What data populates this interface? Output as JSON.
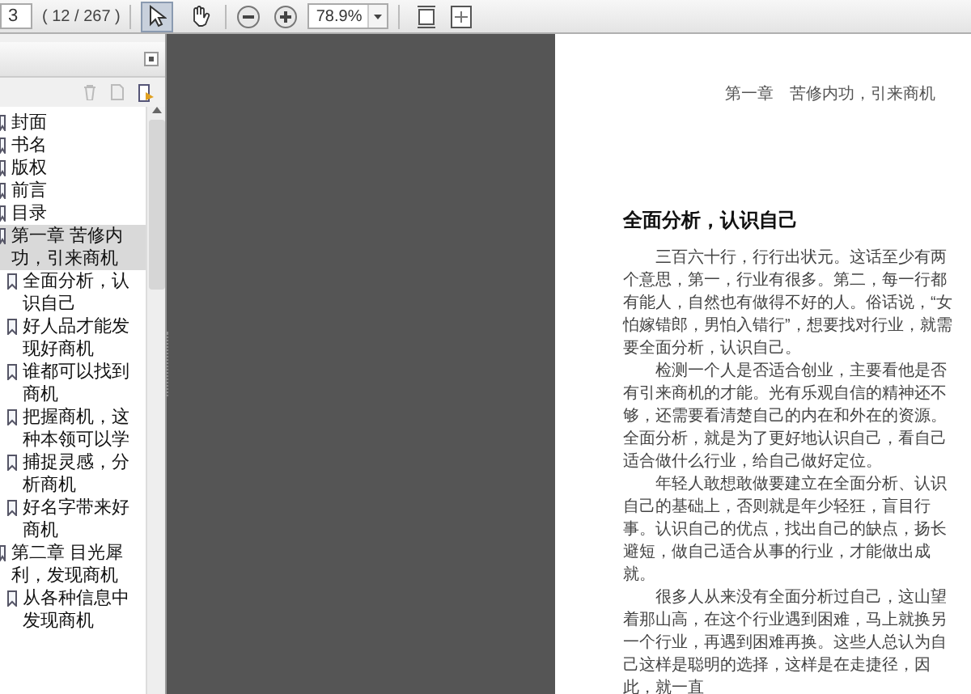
{
  "toolbar": {
    "page_field": "3",
    "page_count": "( 12 / 267 )",
    "tools": [
      {
        "kind": "select",
        "selected": true
      },
      {
        "kind": "hand",
        "selected": false
      }
    ],
    "zoom_field": "78.9%"
  },
  "bookmarks": [
    {
      "label": "封面",
      "selected": false
    },
    {
      "label": "书名",
      "selected": false
    },
    {
      "label": "版权",
      "selected": false
    },
    {
      "label": "前言",
      "selected": false
    },
    {
      "label": "目录",
      "selected": false
    },
    {
      "label": "第一章 苦修内功，引来商机",
      "selected": true,
      "children": [
        {
          "label": "全面分析，认识自己",
          "selected": false
        },
        {
          "label": "好人品才能发现好商机",
          "selected": false
        },
        {
          "label": "谁都可以找到商机",
          "selected": false
        },
        {
          "label": "把握商机，这种本领可以学",
          "selected": false
        },
        {
          "label": "捕捉灵感，分析商机",
          "selected": false
        },
        {
          "label": "好名字带来好商机",
          "selected": false
        }
      ]
    },
    {
      "label": "第二章 目光犀利，发现商机",
      "selected": false,
      "children": [
        {
          "label": "从各种信息中发现商机",
          "selected": false
        }
      ]
    }
  ],
  "page": {
    "running_header": "第一章　苦修内功，引来商机",
    "heading": "全面分析，认识自己",
    "paragraphs": [
      "三百六十行，行行出状元。这话至少有两个意思，第一，行业有很多。第二，每一行都有能人，自然也有做得不好的人。俗话说，“女怕嫁错郎，男怕入错行”，想要找对行业，就需要全面分析，认识自己。",
      "检测一个人是否适合创业，主要看他是否有引来商机的才能。光有乐观自信的精神还不够，还需要看清楚自己的内在和外在的资源。全面分析，就是为了更好地认识自己，看自己适合做什么行业，给自己做好定位。",
      "年轻人敢想敢做要建立在全面分析、认识自己的基础上，否则就是年少轻狂，盲目行事。认识自己的优点，找出自己的缺点，扬长避短，做自己适合从事的行业，才能做出成就。",
      "很多人从来没有全面分析过自己，这山望着那山高，在这个行业遇到困难，马上就换另一个行业，再遇到困难再换。这些人总认为自己这样是聪明的选择，这样是在走捷径，因此，就一直"
    ]
  }
}
